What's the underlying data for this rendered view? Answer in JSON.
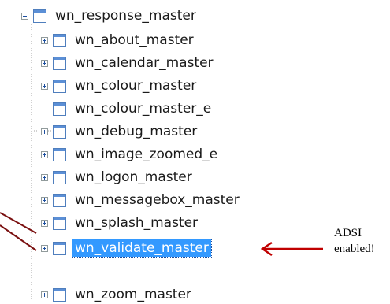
{
  "tree": {
    "root": {
      "label": "wn_response_master",
      "expanded": true
    },
    "children": [
      {
        "label": "wn_about_master",
        "expander": "plus",
        "selected": false
      },
      {
        "label": "wn_calendar_master",
        "expander": "plus",
        "selected": false
      },
      {
        "label": "wn_colour_master",
        "expander": "plus",
        "selected": false
      },
      {
        "label": "wn_colour_master_e",
        "expander": "none",
        "selected": false
      },
      {
        "label": "wn_debug_master",
        "expander": "plus",
        "selected": false
      },
      {
        "label": "wn_image_zoomed_e",
        "expander": "plus",
        "selected": false
      },
      {
        "label": "wn_logon_master",
        "expander": "plus",
        "selected": false
      },
      {
        "label": "wn_messagebox_master",
        "expander": "plus",
        "selected": false
      },
      {
        "label": "wn_splash_master",
        "expander": "plus",
        "selected": false
      },
      {
        "label": "wn_validate_master",
        "expander": "plus",
        "selected": true
      },
      {
        "label": "wn_zoom_master",
        "expander": "plus",
        "selected": false
      }
    ]
  },
  "annotation": {
    "line1": "ADSI",
    "line2": "enabled!"
  },
  "colors": {
    "annotation_arrow": "#c00000",
    "callout_lines": "#7a1010",
    "selection": "#3399ff"
  },
  "icons": {
    "node": "window-icon",
    "expand": "plus-box-icon",
    "collapse": "minus-box-icon"
  }
}
